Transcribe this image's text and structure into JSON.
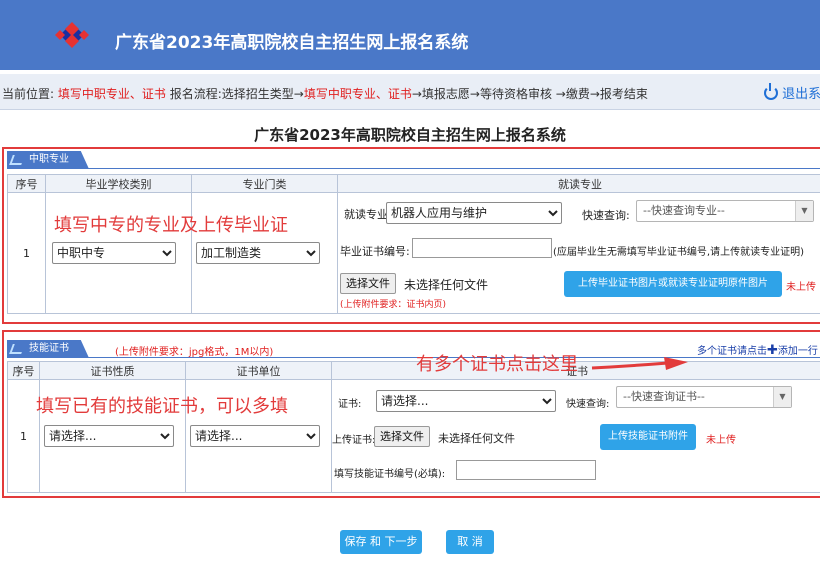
{
  "header": {
    "title": "广东省2023年高职院校自主招生网上报名系统"
  },
  "crumb": {
    "prefix": "当前位置:",
    "current": "填写中职专业、证书",
    "flow_label": "报名流程:选择招生类型→",
    "flow_current": "填写中职专业、证书",
    "flow_rest": "→填报志愿→等待资格审核 →缴费→报考结束",
    "logout": "退出系"
  },
  "page_title": "广东省2023年高职院校自主招生网上报名系统",
  "section1": {
    "tab": "中职专业",
    "columns": [
      "序号",
      "毕业学校类别",
      "专业门类",
      "就读专业"
    ],
    "row_no": "1",
    "school_type": "中职中专",
    "category": "加工制造类",
    "major_label": "就读专业:",
    "major_value": "机器人应用与维护",
    "quick_label": "快速查询:",
    "quick_placeholder": "--快速查询专业--",
    "cert_no_label": "毕业证书编号:",
    "cert_note": "(应届毕业生无需填写毕业证书编号,请上传就读专业证明)",
    "file_button": "选择文件",
    "no_file": "未选择任何文件",
    "upload_button": "上传毕业证书图片或就读专业证明原件图片",
    "upload_status": "未上传",
    "upload_req": "(上传附件要求：证书内页)",
    "annotation": "填写中专的专业及上传毕业证"
  },
  "section2": {
    "tab": "技能证书",
    "req": "(上传附件要求：jpg格式，1M以内)",
    "add_hint": "多个证书请点击",
    "add_link": "添加一行",
    "columns": [
      "序号",
      "证书性质",
      "证书单位",
      "证书"
    ],
    "row_no": "1",
    "nature": "请选择...",
    "unit": "请选择...",
    "cert_label": "证书:",
    "cert_value": "请选择...",
    "quick_label": "快速查询:",
    "quick_placeholder": "--快速查询证书--",
    "upload_label": "上传证书:",
    "file_button": "选择文件",
    "no_file": "未选择任何文件",
    "upload_button": "上传技能证书附件",
    "upload_status": "未上传",
    "cert_no_label": "填写技能证书编号(必填):",
    "annotation_left": "填写已有的技能证书，可以多填",
    "annotation_right": "有多个证书点击这里"
  },
  "buttons": {
    "save": "保存 和 下一步",
    "cancel": "取  消"
  },
  "colors": {
    "header": "#4a78c8",
    "accent_red": "#e23b3b",
    "button_blue": "#2fa3e8"
  },
  "icons": {
    "logo": "diamond-logo-icon",
    "logout": "power-icon",
    "add": "plus-icon"
  }
}
